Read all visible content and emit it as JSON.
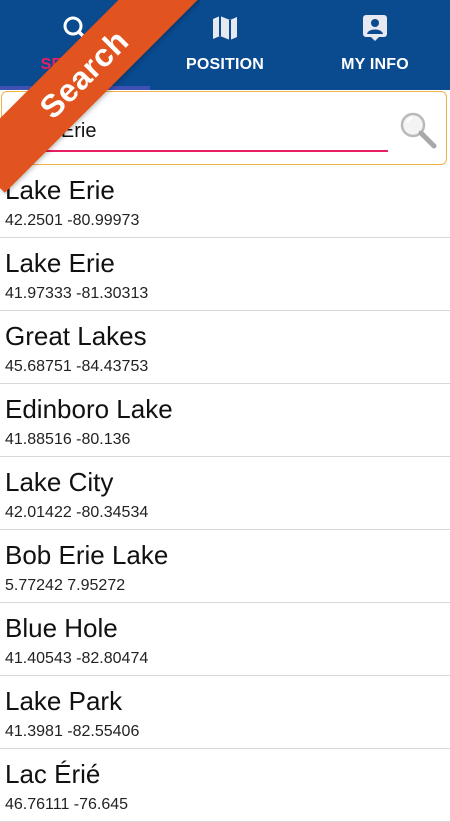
{
  "tabs": [
    {
      "label": "SEARCH",
      "icon": "search-icon",
      "active": true
    },
    {
      "label": "POSITION",
      "icon": "map-icon",
      "active": false
    },
    {
      "label": "MY INFO",
      "icon": "contact-card-icon",
      "active": false
    }
  ],
  "banner": {
    "label": "Search"
  },
  "search": {
    "value": "Lake Erie",
    "button_icon": "magnifier-icon"
  },
  "results": [
    {
      "name": "Lake Erie",
      "coords": "42.2501 -80.99973"
    },
    {
      "name": "Lake Erie",
      "coords": "41.97333 -81.30313"
    },
    {
      "name": "Great Lakes",
      "coords": "45.68751 -84.43753"
    },
    {
      "name": "Edinboro Lake",
      "coords": "41.88516 -80.136"
    },
    {
      "name": "Lake City",
      "coords": "42.01422 -80.34534"
    },
    {
      "name": "Bob Erie Lake",
      "coords": "5.77242 7.95272"
    },
    {
      "name": "Blue Hole",
      "coords": "41.40543 -82.80474"
    },
    {
      "name": "Lake Park",
      "coords": "41.3981 -82.55406"
    },
    {
      "name": "Lac Érié",
      "coords": "46.76111 -76.645"
    }
  ],
  "colors": {
    "tabbar": "#0a4a8f",
    "active_tab_text": "#e91e63",
    "input_underline": "#e91e63",
    "search_border": "#f0b34a",
    "banner": "#e1541f"
  }
}
